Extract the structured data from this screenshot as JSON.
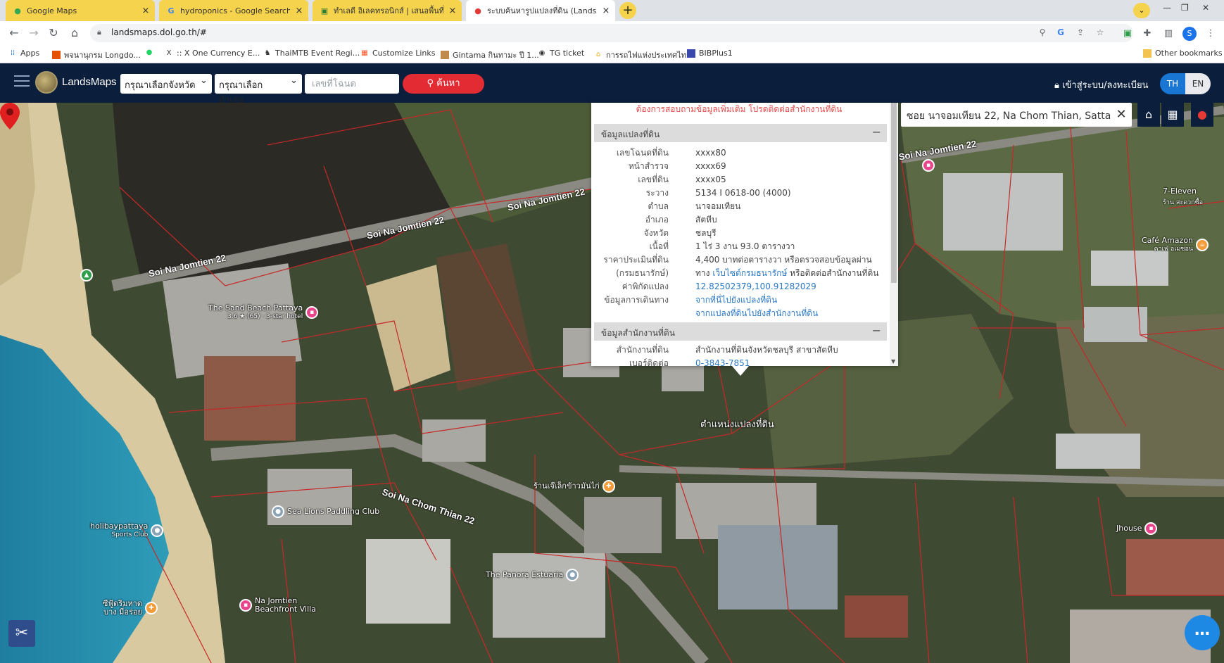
{
  "tabs": [
    {
      "title": "Google Maps",
      "icon": "maps-pin-icon"
    },
    {
      "title": "hydroponics - Google Search",
      "icon": "google-icon"
    },
    {
      "title": "ทำเลดี อิเลคทรอนิกส์ | เสนอพื้นที่เช่า C",
      "icon": "site-icon"
    },
    {
      "title": "ระบบค้นหารูปแปลงที่ดิน (LandsMaps)",
      "icon": "maps-pin-icon"
    }
  ],
  "browser": {
    "url": "landsmaps.dol.go.th/#",
    "profile_initial": "S"
  },
  "bookmarks": [
    {
      "label": "Apps"
    },
    {
      "label": "พจนานุกรม Longdo..."
    },
    {
      "label": ""
    },
    {
      "label": ":: X One Currency E..."
    },
    {
      "label": "ThaiMTB Event Regi..."
    },
    {
      "label": "Customize Links"
    },
    {
      "label": "Gintama กินทามะ ปี 1..."
    },
    {
      "label": "TG ticket"
    },
    {
      "label": "การรถไฟแห่งประเทศไทย"
    },
    {
      "label": "BIBPlus1"
    },
    {
      "label": "Other bookmarks"
    }
  ],
  "app": {
    "brand": "LandsMaps",
    "province_select": "กรุณาเลือกจังหวัด",
    "district_select": "กรุณาเลือกอำเภอ",
    "deed_placeholder": "เลขที่โฉนด",
    "search_label": "ค้นหา",
    "login_label": "เข้าสู่ระบบ/ลงทะเบียน",
    "lang_th": "TH",
    "lang_en": "EN"
  },
  "map": {
    "search_text": "ซอย นาจอมเทียน 22, Na Chom Thian, Satta",
    "road_labels": [
      "Soi Na Jomtien 22",
      "Soi Na Jomtien 22",
      "Soi Na Jomtien 22",
      "Soi Na Chom Thian 22"
    ],
    "pin_label": "ตำแหน่งแปลงที่ดิน",
    "pois": [
      {
        "name": "The Sand Beach Pattaya",
        "sub": "3.6 ★ (65) · 3-star hotel",
        "color": "#e8458b"
      },
      {
        "name": "7-Eleven",
        "sub": "ร้าน สะดวกซื้อ",
        "color": "#e8458b"
      },
      {
        "name": "Café Amazon",
        "sub": "คาเฟ่ อเมซอน",
        "color": "#f29b38"
      },
      {
        "name": "ร้านเจ๊เล็กข้าวมันไก่",
        "sub": "",
        "color": "#f29b38"
      },
      {
        "name": "Sea Lions Paddling Club",
        "sub": "",
        "color": "#8aa3b5"
      },
      {
        "name": "holibaypattaya",
        "sub": "Sports Club",
        "color": "#8aa3b5"
      },
      {
        "name": "The Panora Estuaria",
        "sub": "",
        "color": "#8aa3b5"
      },
      {
        "name": "Na Jomtien Beachfront Villa",
        "sub": "",
        "color": "#e8458b"
      },
      {
        "name": "ซีฟู้ดริมหาด บาง มี่อร่อย",
        "sub": "",
        "color": "#f29b38"
      },
      {
        "name": "Jhouse",
        "sub": "",
        "color": "#e8458b"
      }
    ]
  },
  "popup": {
    "notice": "ต้องการสอบถามข้อมูลเพิ่มเติม โปรดติดต่อสำนักงานที่ดิน",
    "section1": "ข้อมูลแปลงที่ดิน",
    "rows": [
      {
        "k": "เลขโฉนดที่ดิน",
        "v": "xxxx80"
      },
      {
        "k": "หน้าสำรวจ",
        "v": "xxxx69"
      },
      {
        "k": "เลขที่ดิน",
        "v": "xxxx05"
      },
      {
        "k": "ระวาง",
        "v": "5134 I 0618-00 (4000)"
      },
      {
        "k": "ตำบล",
        "v": "นาจอมเทียน"
      },
      {
        "k": "อำเภอ",
        "v": "สัตหีบ"
      },
      {
        "k": "จังหวัด",
        "v": "ชลบุรี"
      },
      {
        "k": "เนื้อที่",
        "v": "1 ไร่ 3 งาน 93.0 ตารางวา"
      },
      {
        "k": "ราคาประเมินที่ดิน",
        "v": "4,400 บาทต่อตารางวา หรือตรวจสอบข้อมูลผ่าน"
      }
    ],
    "treasury_key": "(กรมธนารักษ์)",
    "treasury_pre": "ทาง ",
    "treasury_link": "เว็บไซต์กรมธนารักษ์",
    "treasury_post": " หรือติดต่อสำนักงานที่ดิน",
    "coord_key": "ค่าพิกัดแปลง",
    "coord_val": "12.82502379,100.91282029",
    "travel_key": "ข้อมูลการเดินทาง",
    "travel_link1": "จากที่นี่ไปยังแปลงที่ดิน",
    "travel_link2": "จากแปลงที่ดินไปยังสำนักงานที่ดิน",
    "section2": "ข้อมูลสำนักงานที่ดิน",
    "office_key": "สำนักงานที่ดิน",
    "office_val": "สำนักงานที่ดินจังหวัดชลบุรี สาขาสัตหีบ",
    "phone_key": "เบอร์ติดต่อ",
    "phone_val": "0-3843-7851"
  }
}
